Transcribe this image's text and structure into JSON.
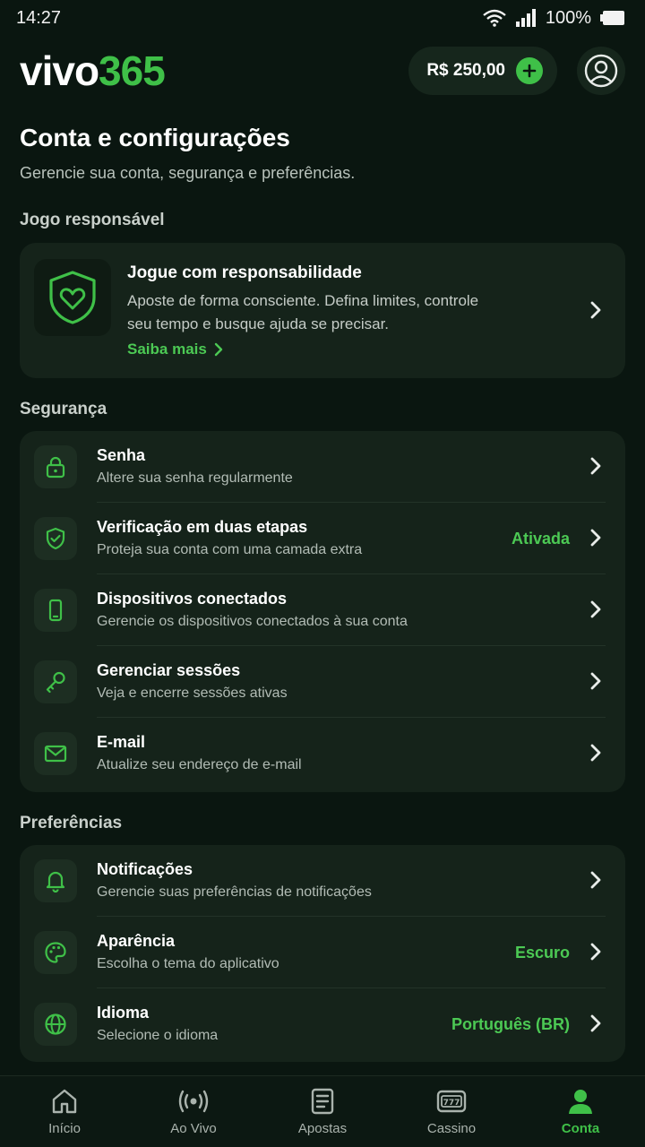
{
  "status": {
    "time": "14:27",
    "battery": "100%"
  },
  "header": {
    "logo_a": "vivo",
    "logo_b": "365",
    "balance": "R$ 250,00"
  },
  "page": {
    "title": "Conta e configurações",
    "subtitle": "Gerencie sua conta, segurança e preferências."
  },
  "responsible": {
    "section": "Jogo responsável",
    "title": "Jogue com responsabilidade",
    "desc": "Aposte de forma consciente. Defina limites, controle seu tempo e busque ajuda se precisar.",
    "link": "Saiba mais"
  },
  "security": {
    "section": "Segurança",
    "items": [
      {
        "title": "Senha",
        "sub": "Altere sua senha regularmente",
        "value": ""
      },
      {
        "title": "Verificação em duas etapas",
        "sub": "Proteja sua conta com uma camada extra",
        "value": "Ativada"
      },
      {
        "title": "Dispositivos conectados",
        "sub": "Gerencie os dispositivos conectados à sua conta",
        "value": ""
      },
      {
        "title": "Gerenciar sessões",
        "sub": "Veja e encerre sessões ativas",
        "value": ""
      },
      {
        "title": "E-mail",
        "sub": "Atualize seu endereço de e-mail",
        "value": ""
      }
    ]
  },
  "preferences": {
    "section": "Preferências",
    "items": [
      {
        "title": "Notificações",
        "sub": "Gerencie suas preferências de notificações",
        "value": ""
      },
      {
        "title": "Aparência",
        "sub": "Escolha o tema do aplicativo",
        "value": "Escuro"
      },
      {
        "title": "Idioma",
        "sub": "Selecione o idioma",
        "value": "Português (BR)"
      }
    ]
  },
  "nav": {
    "items": [
      {
        "label": "Início",
        "icon": "home-icon"
      },
      {
        "label": "Ao Vivo",
        "icon": "live-icon"
      },
      {
        "label": "Apostas",
        "icon": "bets-icon"
      },
      {
        "label": "Cassino",
        "icon": "casino-icon"
      },
      {
        "label": "Conta",
        "icon": "account-icon"
      }
    ],
    "active": "Conta"
  },
  "colors": {
    "accent": "#3fc048",
    "background": "#0a1610",
    "card": "#15231a"
  }
}
